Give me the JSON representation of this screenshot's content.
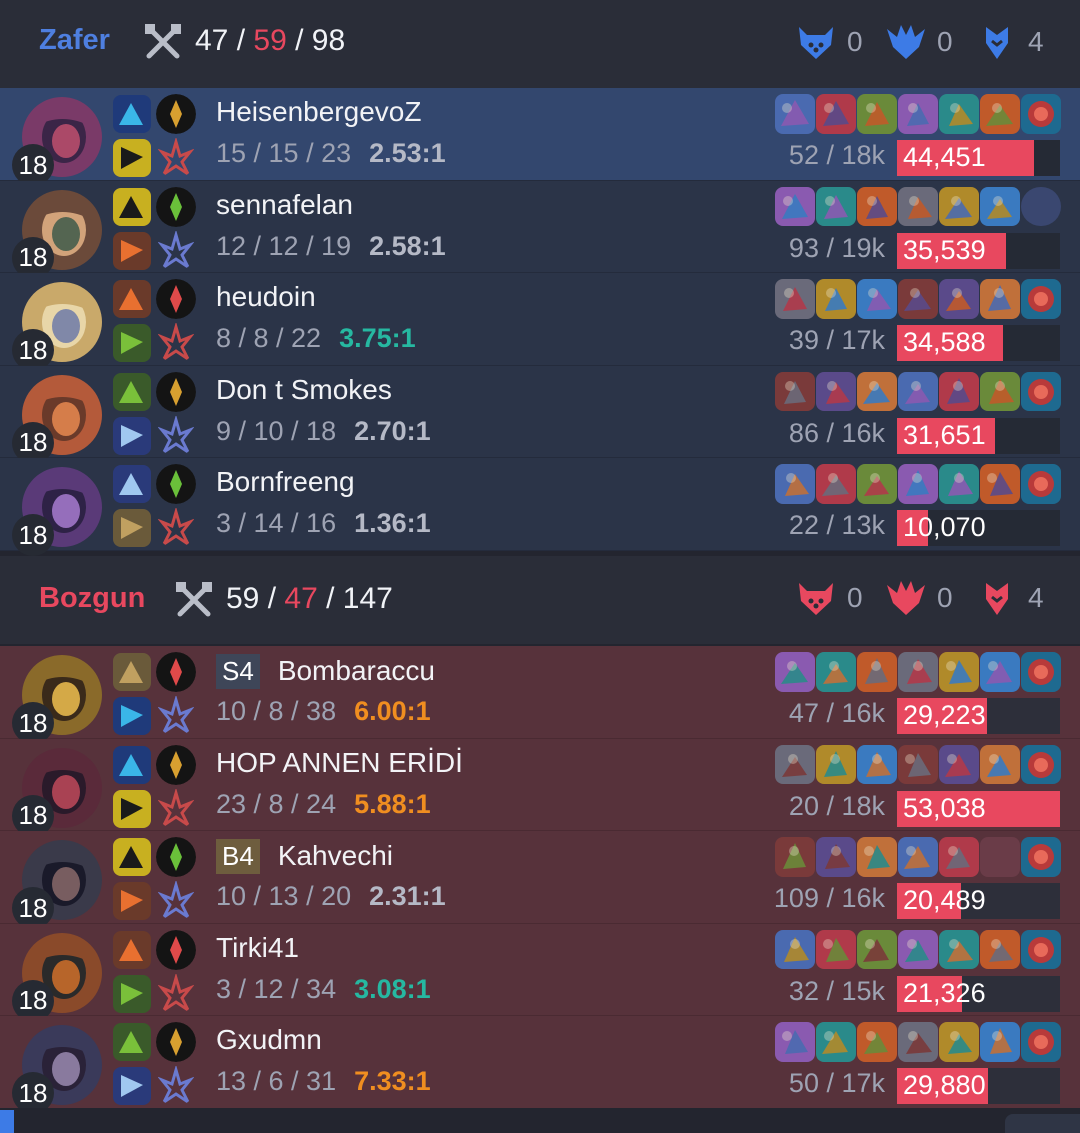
{
  "teams": [
    {
      "name": "Zafer",
      "name_color": "#4e7fe0",
      "kills": "47",
      "deaths": "59",
      "assists": "98",
      "objectives": [
        {
          "icon": "baron-icon",
          "count": "0"
        },
        {
          "icon": "dragon-icon",
          "count": "0"
        },
        {
          "icon": "tower-icon",
          "count": "4"
        }
      ],
      "players": [
        {
          "level": "18",
          "tag": "",
          "name": "HeisenbergevoZ",
          "kda": "15 / 15 / 23",
          "ratio": "2.53:1",
          "ratio_style": "gray",
          "cs": "52 / 18k",
          "damage": "44,451",
          "damage_frac": 0.84,
          "empty_slot": false
        },
        {
          "level": "18",
          "tag": "",
          "name": "sennafelan",
          "kda": "12 / 12 / 19",
          "ratio": "2.58:1",
          "ratio_style": "gray",
          "cs": "93 / 19k",
          "damage": "35,539",
          "damage_frac": 0.67,
          "empty_slot": true
        },
        {
          "level": "18",
          "tag": "",
          "name": "heudoin",
          "kda": "8 / 8 / 22",
          "ratio": "3.75:1",
          "ratio_style": "teal",
          "cs": "39 / 17k",
          "damage": "34,588",
          "damage_frac": 0.65,
          "empty_slot": false
        },
        {
          "level": "18",
          "tag": "",
          "name": "Don t Smokes",
          "kda": "9 / 10 / 18",
          "ratio": "2.70:1",
          "ratio_style": "gray",
          "cs": "86 / 16k",
          "damage": "31,651",
          "damage_frac": 0.6,
          "empty_slot": false
        },
        {
          "level": "18",
          "tag": "",
          "name": "Bornfreeng",
          "kda": "3 / 14 / 16",
          "ratio": "1.36:1",
          "ratio_style": "gray",
          "cs": "22 / 13k",
          "damage": "10,070",
          "damage_frac": 0.19,
          "empty_slot": false
        }
      ]
    },
    {
      "name": "Bozgun",
      "name_color": "#e8485f",
      "kills": "59",
      "deaths": "47",
      "assists": "147",
      "objectives": [
        {
          "icon": "baron-icon",
          "count": "0"
        },
        {
          "icon": "dragon-icon",
          "count": "0"
        },
        {
          "icon": "tower-icon",
          "count": "4"
        }
      ],
      "players": [
        {
          "level": "18",
          "tag": "S4",
          "tag_color": "#3e4658",
          "name": "Bombaraccu",
          "kda": "10 / 8 / 38",
          "ratio": "6.00:1",
          "ratio_style": "orange",
          "cs": "47 / 16k",
          "damage": "29,223",
          "damage_frac": 0.55,
          "empty_slot": false
        },
        {
          "level": "18",
          "tag": "",
          "name": "HOP ANNEN ERİDİ",
          "kda": "23 / 8 / 24",
          "ratio": "5.88:1",
          "ratio_style": "orange",
          "cs": "20 / 18k",
          "damage": "53,038",
          "damage_frac": 1.0,
          "empty_slot": false
        },
        {
          "level": "18",
          "tag": "B4",
          "tag_color": "#6e5d3e",
          "name": "Kahvechi",
          "kda": "10 / 13 / 20",
          "ratio": "2.31:1",
          "ratio_style": "gray",
          "cs": "109 / 16k",
          "damage": "20,489",
          "damage_frac": 0.39,
          "empty_slot": true
        },
        {
          "level": "18",
          "tag": "",
          "name": "Tirki41",
          "kda": "3 / 12 / 34",
          "ratio": "3.08:1",
          "ratio_style": "teal",
          "cs": "32 / 15k",
          "damage": "21,326",
          "damage_frac": 0.4,
          "empty_slot": false
        },
        {
          "level": "18",
          "tag": "",
          "name": "Gxudmn",
          "kda": "13 / 6 / 31",
          "ratio": "7.33:1",
          "ratio_style": "orange",
          "cs": "50 / 17k",
          "damage": "29,880",
          "damage_frac": 0.56,
          "empty_slot": false
        }
      ]
    }
  ]
}
